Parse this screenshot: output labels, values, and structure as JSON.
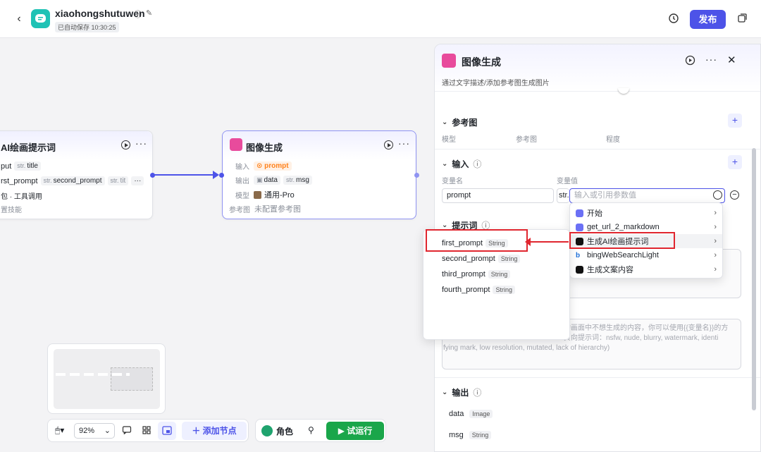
{
  "header": {
    "title": "xiaohongshutuwen",
    "autosave": "已自动保存 10:30:25",
    "publish_label": "发布"
  },
  "node_ai_prompt": {
    "title": "AI绘画提示词",
    "input_var": "put",
    "output_title": "title",
    "output_first": "rst_prompt",
    "output_second": "second_prompt",
    "output_more": "tit",
    "skill_text": "包 · 工具调用",
    "skill_hint": "置技能",
    "type_str": "str."
  },
  "node_image": {
    "title": "图像生成",
    "input_label": "输入",
    "input_value": "prompt",
    "output_label": "输出",
    "output_data": "data",
    "output_msg": "msg",
    "model_label": "模型",
    "model_value": "通用-Pro",
    "ref_label": "参考图",
    "ref_value": "未配置参考图",
    "type_str": "str."
  },
  "toolbar": {
    "zoom": "92%",
    "add_node": "添加节点",
    "role": "角色",
    "test_run": "试运行"
  },
  "panel": {
    "title": "图像生成",
    "description": "通过文字描述/添加参考图生成图片",
    "ref_section": "参考图",
    "ref_cols": [
      "模型",
      "参考图",
      "程度"
    ],
    "input_section": "输入",
    "var_name_label": "变量名",
    "var_value_label": "变量值",
    "var_name_value": "prompt",
    "var_type": "str.",
    "var_value_placeholder": "输入或引用参数值",
    "prompt_section": "提示词",
    "negative_placeholder_1": "的画面中不想生成的内容，你可以使用{{变量名}}的方",
    "negative_placeholder_2": "负向提示词：nsfw, nude, blurry, watermark, identi",
    "negative_placeholder_3": "fying mark, low resolution, mutated, lack of hierarchy)",
    "output_section": "输出",
    "outputs": [
      {
        "name": "data",
        "type": "Image"
      },
      {
        "name": "msg",
        "type": "String"
      }
    ]
  },
  "ref_menu": {
    "items": [
      "开始",
      "get_url_2_markdown",
      "生成AI绘画提示词",
      "bingWebSearchLight",
      "生成文案内容"
    ]
  },
  "var_menu": {
    "items": [
      {
        "name": "first_prompt",
        "type": "String"
      },
      {
        "name": "second_prompt",
        "type": "String"
      },
      {
        "name": "third_prompt",
        "type": "String"
      },
      {
        "name": "fourth_prompt",
        "type": "String"
      }
    ]
  },
  "colors": {
    "accent": "#4d53e8",
    "run_green": "#1aa64a",
    "highlight_red": "#e0262f",
    "logo_teal": "#1fc2b5"
  }
}
